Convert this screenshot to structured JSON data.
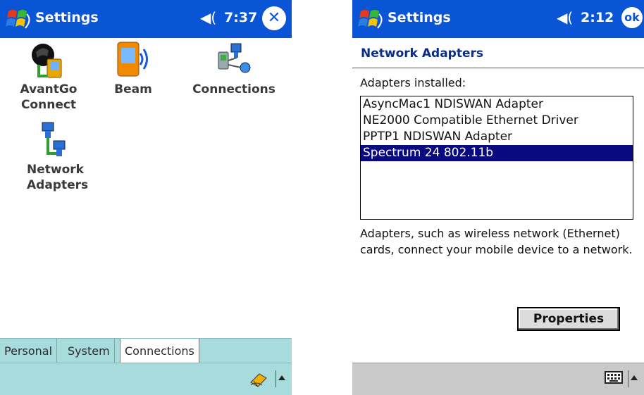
{
  "left": {
    "title": "Settings",
    "time": "7:37",
    "close_symbol": "✕",
    "items": [
      {
        "label": "AvantGo\nConnect",
        "icon": "avantgo-connect-icon"
      },
      {
        "label": "Beam",
        "icon": "beam-icon"
      },
      {
        "label": "Connections",
        "icon": "connections-icon"
      },
      {
        "label": "Network\nAdapters",
        "icon": "network-adapters-icon"
      }
    ],
    "tabs": [
      {
        "label": "Personal"
      },
      {
        "label": "System"
      },
      {
        "label": "Connections",
        "active": true
      }
    ],
    "icons": {
      "start": "windows-start-icon",
      "volume": "speaker-icon",
      "input": "handwriting-input-icon"
    }
  },
  "right": {
    "title": "Settings",
    "time": "2:12",
    "ok_label": "ok",
    "header": "Network Adapters",
    "adapters_label": "Adapters installed:",
    "adapters": [
      "AsyncMac1 NDISWAN Adapter",
      "NE2000 Compatible Ethernet Driver",
      "PPTP1 NDISWAN Adapter",
      "Spectrum 24 802.11b"
    ],
    "selected_adapter": "Spectrum 24 802.11b",
    "description": "Adapters, such as wireless network (Ethernet) cards, connect your mobile device to a network.",
    "properties_button": "Properties",
    "icons": {
      "start": "windows-start-icon",
      "volume": "speaker-icon",
      "input": "keyboard-icon"
    }
  },
  "colors": {
    "titlebar": "#0a55d6",
    "tabbar": "#a8dcdc",
    "selection": "#0a0a80",
    "header": "#0a2d8a"
  }
}
